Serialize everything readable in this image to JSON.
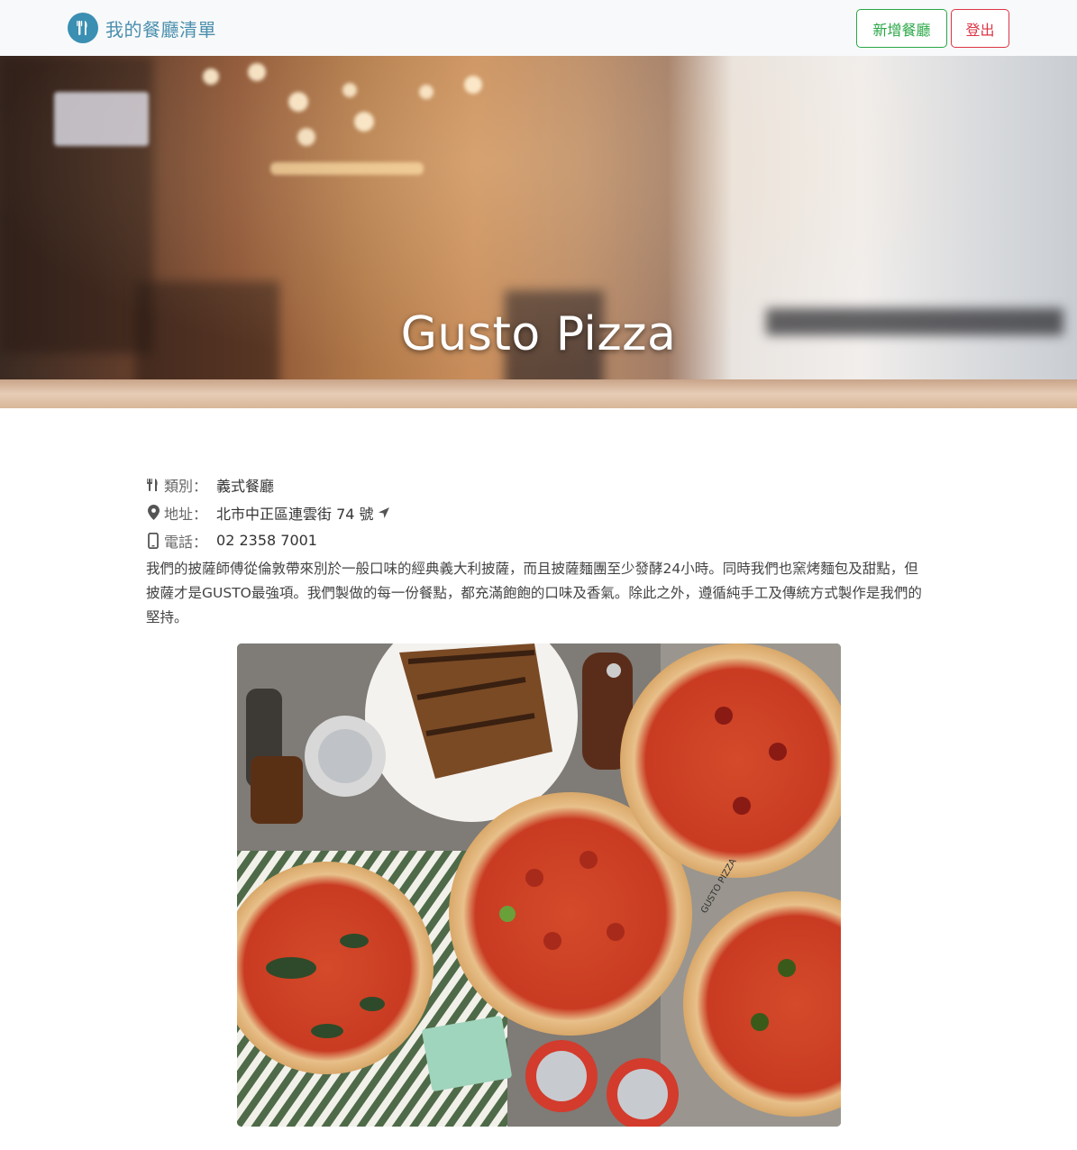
{
  "navbar": {
    "brand_text": "我的餐廳清單",
    "brand_icon": "utensils-icon",
    "add_button": "新增餐廳",
    "logout_button": "登出"
  },
  "banner": {
    "title": "Gusto Pizza"
  },
  "restaurant": {
    "category_label": "類別：",
    "category": "義式餐廳",
    "category_icon": "utensils-icon",
    "address_label": "地址：",
    "address": "北市中正區連雲街 74 號",
    "address_icon": "map-marker-icon",
    "direction_icon": "location-arrow-icon",
    "phone_label": "電話：",
    "phone": "02 2358 7001",
    "phone_icon": "mobile-phone-icon",
    "description": "我們的披薩師傅從倫敦帶來別於一般口味的經典義大利披薩，而且披薩麵團至少發酵24小時。同時我們也窯烤麵包及甜點，但披薩才是GUSTO最強項。我們製做的每一份餐點，都充滿飽飽的口味及香氣。除此之外，遵循純手工及傳統方式製作是我們的堅持。",
    "photo_text": "GUSTO PIZZA"
  },
  "colors": {
    "brand": "#4a8fae",
    "add_button": "#28a745",
    "logout_button": "#dc3545"
  }
}
